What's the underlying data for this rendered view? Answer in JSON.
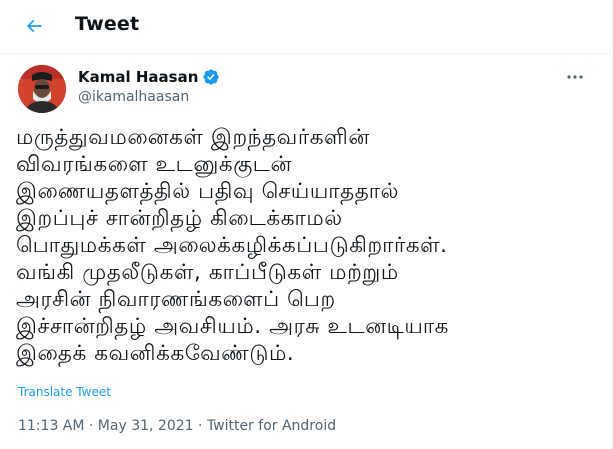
{
  "header": {
    "title": "Tweet"
  },
  "author": {
    "display_name": "Kamal Haasan",
    "handle": "@ikamalhaasan",
    "verified": true
  },
  "tweet": {
    "text": "மருத்துவமனைகள் இறந்தவர்களின்\nவிவரங்களை உடனுக்குடன்\nஇணையதளத்தில் பதிவு செய்யாததால்\nஇறப்புச் சான்றிதழ் கிடைக்காமல்\nபொதுமக்கள் அலைக்கழிக்கப்படுகிறார்கள்.\nவங்கி முதலீடுகள், காப்பீடுகள் மற்றும்\nஅரசின் நிவாரணங்களைப் பெற\nஇச்சான்றிதழ் அவசியம். அரசு உடனடியாக\nஇதைக் கவனிக்கவேண்டும்.",
    "translate_label": "Translate Tweet",
    "timestamp": "11:13 AM · May 31, 2021 · Twitter for Android"
  },
  "colors": {
    "accent": "#1d9bf0",
    "secondary_text": "#536471",
    "border": "#eff3f4"
  }
}
